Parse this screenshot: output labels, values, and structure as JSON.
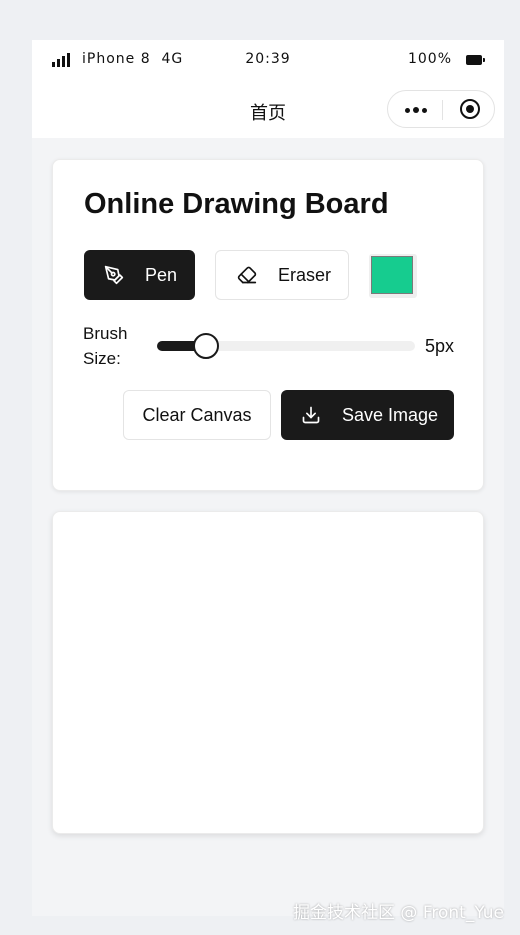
{
  "status_bar": {
    "carrier": "iPhone 8  4G",
    "time": "20:39",
    "battery": "100%",
    "icons": [
      "signal-icon",
      "battery-icon"
    ]
  },
  "nav": {
    "title": "首页",
    "icons": [
      "more-icon",
      "close-target-icon"
    ]
  },
  "board": {
    "title": "Online Drawing Board",
    "tools": [
      {
        "label": "Pen",
        "icon": "pen-icon",
        "active": true
      },
      {
        "label": "Eraser",
        "icon": "eraser-icon",
        "active": false
      }
    ],
    "color": "#16cc8f",
    "brush_label": "Brush Size:",
    "brush_size": 5,
    "brush_size_text": "5px",
    "brush_min": 1,
    "brush_max": 50,
    "clear_label": "Clear Canvas",
    "save_label": "Save Image",
    "save_icon": "download-icon"
  },
  "watermark": "掘金技术社区 @ Front_Yue",
  "colors": {
    "accent": "#1a1a1a",
    "page_bg": "#f3f4f6",
    "card_bg": "#ffffff"
  }
}
